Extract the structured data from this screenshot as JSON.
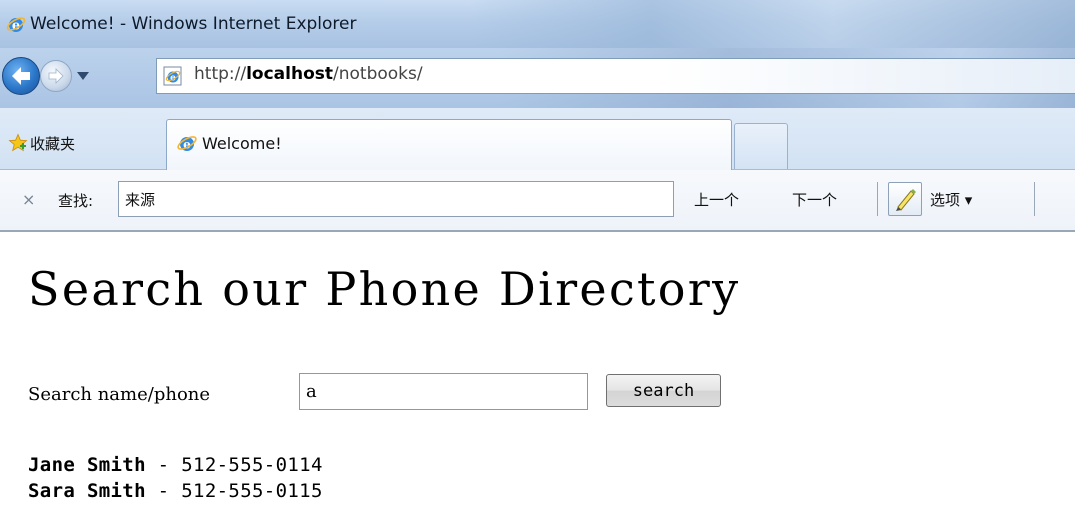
{
  "window": {
    "title": "Welcome! - Windows Internet Explorer"
  },
  "address_bar": {
    "url_prefix": "http://",
    "url_host": "localhost",
    "url_path": "/notbooks/"
  },
  "favorites": {
    "label": "收藏夹"
  },
  "tabs": [
    {
      "label": "Welcome!",
      "active": true
    }
  ],
  "find_bar": {
    "close_symbol": "×",
    "label": "查找:",
    "value": "来源",
    "prev_label": "上一个",
    "next_label": "下一个",
    "options_label": "选项 ▾"
  },
  "page": {
    "heading": "Search our Phone Directory",
    "search_label": "Search name/phone",
    "search_value": "a",
    "search_button": "search",
    "results": [
      {
        "name": "Jane Smith",
        "separator": " - ",
        "phone": "512-555-0114"
      },
      {
        "name": "Sara Smith",
        "separator": " - ",
        "phone": "512-555-0115"
      }
    ]
  },
  "colors": {
    "chrome_blue": "#b5cde9",
    "ie_logo_blue": "#1c6fd1",
    "ie_logo_ring": "#f2b632",
    "star_yellow": "#f5c518"
  }
}
